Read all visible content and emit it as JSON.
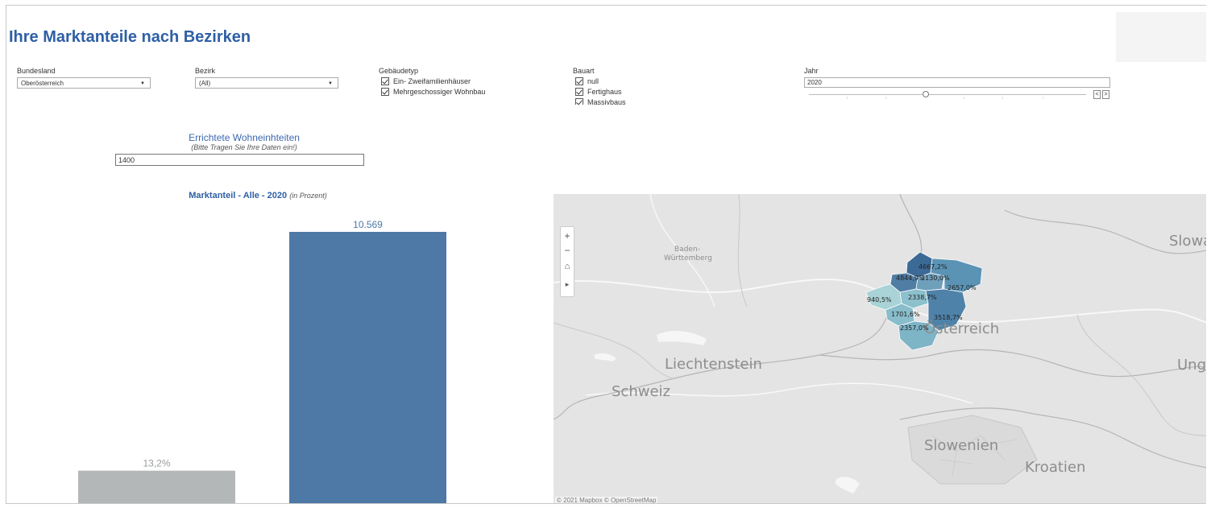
{
  "header": {
    "title": "Ihre Marktanteile nach Bezirken"
  },
  "filters": {
    "bundesland": {
      "label": "Bundesland",
      "value": "Oberösterreich"
    },
    "bezirk": {
      "label": "Bezirk",
      "value": "(All)"
    },
    "gebaeudetyp": {
      "label": "Gebäudetyp",
      "options": [
        "Ein- Zweifamilienhäuser",
        "Mehrgeschossiger Wohnbau"
      ]
    },
    "bauart": {
      "label": "Bauart",
      "options": [
        "null",
        "Fertighaus",
        "Massivbaus"
      ]
    },
    "jahr": {
      "label": "Jahr",
      "value": "2020",
      "slider_position": 0.41
    }
  },
  "input_param": {
    "title": "Errichtete Wohneinhteiten",
    "subtitle": "(Bitte Tragen Sie Ihre Daten ein!)",
    "value": "1400"
  },
  "chart_title": {
    "main": "Marktanteil - Alle -",
    "year": "2020",
    "unit": "(in Prozent)"
  },
  "chart_data": {
    "type": "bar",
    "categories": [
      "",
      ""
    ],
    "values": [
      1.32,
      10.569
    ],
    "data_labels": [
      "13,2%",
      "10.569"
    ],
    "colors": [
      "#b4b7b8",
      "#4e79a7"
    ],
    "label_colors": [
      "#9a9d9f",
      "#4e79a7"
    ],
    "ylim": [
      0,
      10.569
    ]
  },
  "map": {
    "zoom_controls": [
      "+",
      "−",
      "⌂",
      "▸"
    ],
    "labels": [
      "Baden-",
      "Württemberg",
      "Slowa",
      "Liechtenstein",
      "Schweiz",
      "Österreich",
      "Ung",
      "Slowenien",
      "Kroatien"
    ],
    "district_values": [
      "4667,2%",
      "4844,9%",
      "2130,0%",
      "2657,0%",
      "2338,7%",
      "940,5%",
      "1701,6%",
      "3518,7%",
      "2357,0%"
    ],
    "attribution": "© 2021 Mapbox  © OpenStreetMap"
  },
  "colors": {
    "title": "#2e5fa5",
    "accent": "#4e79a7"
  }
}
